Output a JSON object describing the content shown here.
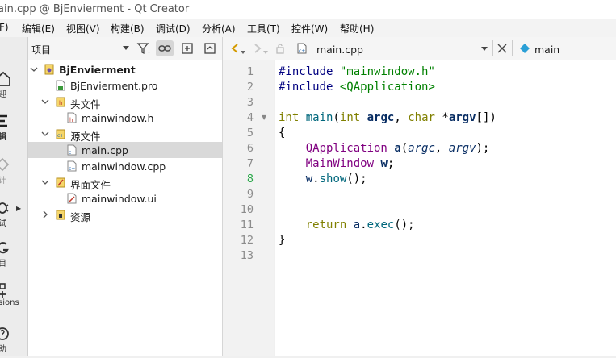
{
  "window": {
    "title": "ain.cpp @ BjEnvierment - Qt Creator"
  },
  "menu": [
    "F)",
    "编辑(E)",
    "视图(V)",
    "构建(B)",
    "调试(D)",
    "分析(A)",
    "工具(T)",
    "控件(W)",
    "帮助(H)"
  ],
  "modes": [
    {
      "label": "迎",
      "icon": "home-icon"
    },
    {
      "label": "辑",
      "icon": "edit-icon"
    },
    {
      "label": "计",
      "icon": "design-icon"
    },
    {
      "label": "试",
      "icon": "debug-icon"
    },
    {
      "label": "目",
      "icon": "project-icon"
    },
    {
      "label": "sions",
      "icon": "extensions-icon"
    },
    {
      "label": "助",
      "icon": "help-icon"
    }
  ],
  "project": {
    "panel_title": "项目",
    "tree": [
      {
        "label": "BjEnvierment",
        "bold": true
      },
      {
        "label": "BjEnvierment.pro"
      },
      {
        "label": "头文件"
      },
      {
        "label": "mainwindow.h"
      },
      {
        "label": "源文件"
      },
      {
        "label": "main.cpp"
      },
      {
        "label": "mainwindow.cpp"
      },
      {
        "label": "界面文件"
      },
      {
        "label": "mainwindow.ui"
      },
      {
        "label": "资源"
      }
    ]
  },
  "editor": {
    "file_name": "main.cpp",
    "symbol": "main",
    "current_line": 8,
    "line_numbers": [
      "1",
      "2",
      "3",
      "4",
      "5",
      "6",
      "7",
      "8",
      "9",
      "10",
      "11",
      "12",
      "13"
    ],
    "code": {
      "l1_directive": "#include",
      "l1_file": "\"mainwindow.h\"",
      "l2_directive": "#include",
      "l2_file": "<QApplication>",
      "l4_ret": "int",
      "l4_fn": "main",
      "l4_open": "(",
      "l4_t1": "int",
      "l4_p1": "argc",
      "l4_comma": ",",
      "l4_t2": "char",
      "l4_star": "*",
      "l4_p2": "argv",
      "l4_close": "[])",
      "l5": "{",
      "l6_type": "QApplication",
      "l6_var": "a",
      "l6_open": "(",
      "l6_a1": "argc",
      "l6_comma": ", ",
      "l6_a2": "argv",
      "l6_close": ");",
      "l7_type": "MainWindow",
      "l7_var": "w",
      "l7_end": ";",
      "l8_obj": "w",
      "l8_dot": ".",
      "l8_fn": "show",
      "l8_end": "();",
      "l11_kw": "return",
      "l11_obj": "a",
      "l11_dot": ".",
      "l11_fn": "exec",
      "l11_end": "();",
      "l12": "}"
    }
  }
}
